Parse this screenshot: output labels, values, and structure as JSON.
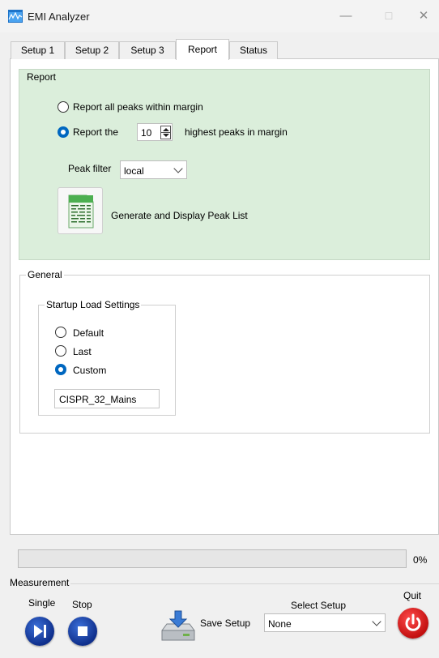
{
  "window": {
    "title": "EMI Analyzer",
    "minimize": "—",
    "maximize": "☐",
    "close": "✕"
  },
  "tabs": [
    {
      "label": "Setup 1",
      "active": false
    },
    {
      "label": "Setup 2",
      "active": false
    },
    {
      "label": "Setup 3",
      "active": false
    },
    {
      "label": "Report",
      "active": true
    },
    {
      "label": "Status",
      "active": false
    }
  ],
  "report": {
    "legend": "Report",
    "option_all": {
      "label": "Report all peaks within margin",
      "checked": false
    },
    "option_top": {
      "label_before": "Report the",
      "label_after": "highest peaks in margin",
      "checked": true,
      "count": "10"
    },
    "peak_filter": {
      "label": "Peak filter",
      "value": "local"
    },
    "generate_button": {
      "label": "Generate and Display Peak List",
      "icon": "spreadsheet-icon"
    }
  },
  "general": {
    "legend": "General",
    "startup": {
      "legend": "Startup Load Settings",
      "options": [
        {
          "label": "Default",
          "checked": false
        },
        {
          "label": "Last",
          "checked": false
        },
        {
          "label": "Custom",
          "checked": true
        }
      ],
      "custom_value": "CISPR_32_Mains"
    }
  },
  "progress": {
    "value": 0,
    "text": "0%"
  },
  "measurement": {
    "legend": "Measurement",
    "single_label": "Single",
    "stop_label": "Stop",
    "quit_label": "Quit",
    "save_label": "Save Setup",
    "select_setup_label": "Select Setup",
    "select_setup_value": "None"
  },
  "colors": {
    "report_bg": "#dbeedb",
    "accent": "#0067c0",
    "play_button": "#1f4fb8",
    "quit_button": "#e01b1b"
  }
}
